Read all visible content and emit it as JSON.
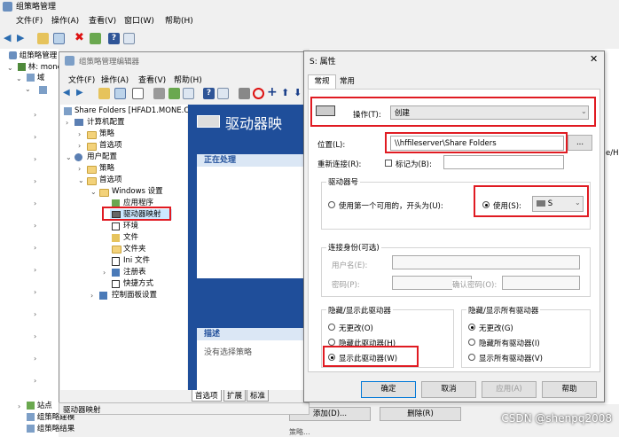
{
  "gpm": {
    "title": "组策略管理",
    "menu": [
      "文件(F)",
      "操作(A)",
      "查看(V)",
      "窗口(W)",
      "帮助(H)"
    ],
    "tree": {
      "root": "组策略管理",
      "forest": "林: mone",
      "domains": "域",
      "sites": "站点",
      "modeling": "组策略建模",
      "results": "组策略结果"
    },
    "right_partial": "e/H",
    "bottom_buttons": [
      "添加(D)...",
      "删除(R)"
    ],
    "bottom_text": "策略..."
  },
  "gpe": {
    "title": "组策略管理编辑器",
    "menu": [
      "文件(F)",
      "操作(A)",
      "查看(V)",
      "帮助(H)"
    ],
    "tree": [
      {
        "label": "Share Folders [HFAD1.MONE.C",
        "indent": 0
      },
      {
        "label": "计算机配置",
        "indent": 1
      },
      {
        "label": "策略",
        "indent": 2
      },
      {
        "label": "首选项",
        "indent": 2
      },
      {
        "label": "用户配置",
        "indent": 1
      },
      {
        "label": "策略",
        "indent": 2
      },
      {
        "label": "首选项",
        "indent": 2
      },
      {
        "label": "Windows 设置",
        "indent": 3
      },
      {
        "label": "应用程序",
        "indent": 4
      },
      {
        "label": "驱动器映射",
        "indent": 4
      },
      {
        "label": "环境",
        "indent": 4
      },
      {
        "label": "文件",
        "indent": 4
      },
      {
        "label": "文件夹",
        "indent": 4
      },
      {
        "label": "Ini 文件",
        "indent": 4
      },
      {
        "label": "注册表",
        "indent": 4
      },
      {
        "label": "快捷方式",
        "indent": 4
      },
      {
        "label": "控制面板设置",
        "indent": 3
      }
    ],
    "header_title": "驱动器映",
    "processing": "正在处理",
    "description_title": "描述",
    "description_text": "没有选择策略",
    "tabs": [
      "首选项",
      "扩展",
      "标准"
    ],
    "status": "驱动器映射"
  },
  "dialog": {
    "title": "S: 属性",
    "tabs": [
      "常规",
      "常用"
    ],
    "action_label": "操作(T):",
    "action_value": "创建",
    "location_label": "位置(L):",
    "location_value": "\\\\hffileserver\\Share Folders",
    "browse": "...",
    "reconnect_label": "重新连接(R):",
    "label_as": "标记为(B):",
    "drive_letter_group": "驱动器号",
    "use_first": "使用第一个可用的，开头为(U):",
    "use": "使用(S):",
    "drive_value": "S",
    "connect_as_group": "连接身份(可选)",
    "username": "用户名(E):",
    "password": "密码(P):",
    "confirm_password": "确认密码(O):",
    "hide_show_group": "隐藏/显示此驱动器",
    "hide_show_all_group": "隐藏/显示所有驱动器",
    "opt1": [
      "无更改(O)",
      "隐藏此驱动器(H)",
      "显示此驱动器(W)"
    ],
    "opt2": [
      "无更改(G)",
      "隐藏所有驱动器(I)",
      "显示所有驱动器(V)"
    ],
    "buttons": [
      "确定",
      "取消",
      "应用(A)",
      "帮助"
    ]
  },
  "watermark": "CSDN @shenpq2008",
  "colors": {
    "accent": "#1f4e9a",
    "highlight": "#e01b22",
    "selected": "#cce8ff"
  }
}
